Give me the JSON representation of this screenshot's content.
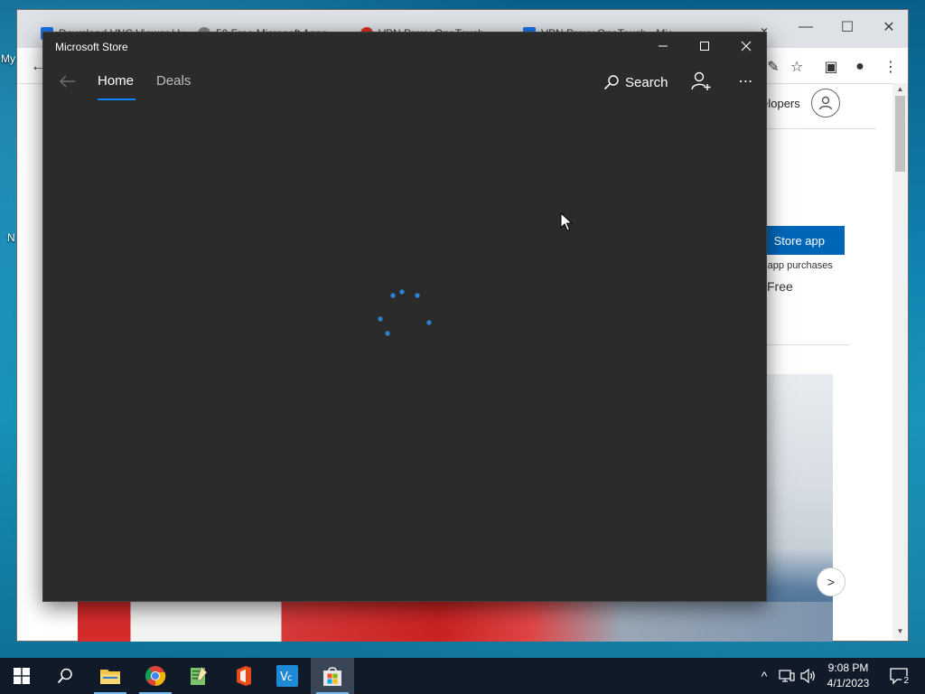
{
  "desktop": {
    "labels": [
      "My",
      "N"
    ]
  },
  "browser": {
    "tabs": [
      {
        "title": "Download VNC Viewer | VNC®",
        "icon": "vnc-tab-icon"
      },
      {
        "title": "50 Free Microsoft Apps",
        "icon": "search-tab-icon"
      },
      {
        "title": "VPN Proxy OneTouch",
        "icon": "vpn-tab-icon"
      },
      {
        "title": "VPN Proxy OneTouch - Microsoft Store",
        "icon": "store-tab-icon"
      }
    ],
    "page": {
      "nav_developers": "Developers",
      "store_button": "Store app",
      "in_app_text": "-app purchases",
      "price_text": "Free"
    }
  },
  "store": {
    "title": "Microsoft Store",
    "nav": {
      "tabs": [
        {
          "label": "Home",
          "active": true
        },
        {
          "label": "Deals",
          "active": false
        }
      ],
      "search_label": "Search"
    },
    "state": "loading",
    "accent_color": "#0a84ff"
  },
  "taskbar": {
    "apps": [
      "start",
      "search",
      "file-explorer",
      "chrome",
      "notepad",
      "office",
      "vnc-viewer",
      "microsoft-store"
    ],
    "clock_time": "9:08 PM",
    "clock_date": "4/1/2023",
    "notification_count": "2"
  }
}
